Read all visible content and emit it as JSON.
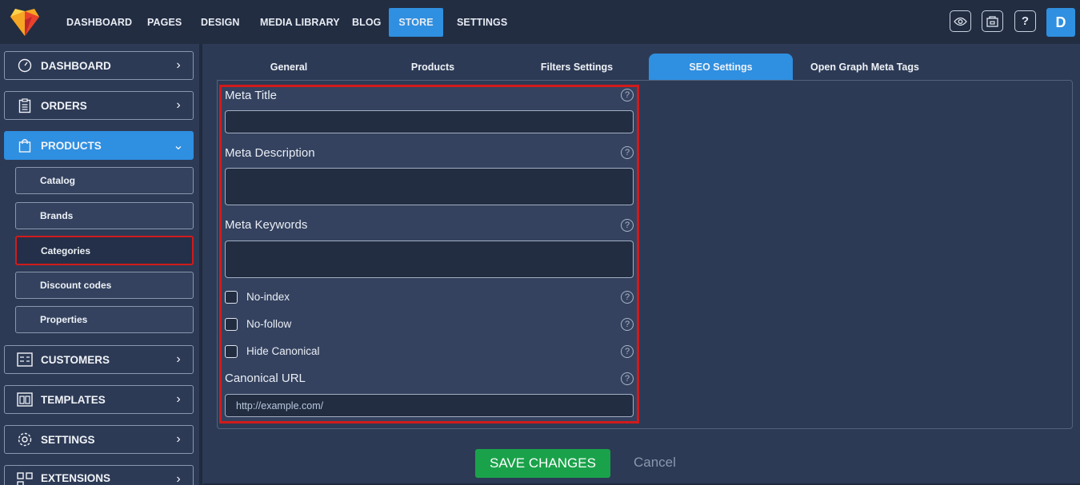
{
  "topnav": {
    "items": [
      {
        "label": "DASHBOARD"
      },
      {
        "label": "PAGES"
      },
      {
        "label": "DESIGN"
      },
      {
        "label": "MEDIA LIBRARY"
      },
      {
        "label": "BLOG"
      },
      {
        "label": "STORE",
        "active": true
      },
      {
        "label": "SETTINGS"
      }
    ],
    "icons": [
      "eye-icon",
      "store-icon",
      "help-icon"
    ],
    "help_glyph": "?",
    "avatar": "D"
  },
  "sidebar": {
    "main": [
      {
        "label": "DASHBOARD",
        "icon": "gauge-icon"
      },
      {
        "label": "ORDERS",
        "icon": "clipboard-icon"
      },
      {
        "label": "PRODUCTS",
        "icon": "bag-icon",
        "active": true
      },
      {
        "label": "CUSTOMERS",
        "icon": "contacts-icon"
      },
      {
        "label": "TEMPLATES",
        "icon": "template-icon"
      },
      {
        "label": "SETTINGS",
        "icon": "gear-icon"
      },
      {
        "label": "EXTENSIONS",
        "icon": "grid-icon"
      }
    ],
    "sub": [
      {
        "label": "Catalog"
      },
      {
        "label": "Brands"
      },
      {
        "label": "Categories",
        "selected": true
      },
      {
        "label": "Discount codes"
      },
      {
        "label": "Properties"
      }
    ]
  },
  "tabs": [
    {
      "label": "General"
    },
    {
      "label": "Products"
    },
    {
      "label": "Filters Settings"
    },
    {
      "label": "SEO Settings",
      "active": true
    },
    {
      "label": "Open Graph Meta Tags"
    }
  ],
  "seo": {
    "meta_title_label": "Meta Title",
    "meta_title_value": "",
    "meta_description_label": "Meta Description",
    "meta_description_value": "",
    "meta_keywords_label": "Meta Keywords",
    "meta_keywords_value": "",
    "noindex_label": "No-index",
    "nofollow_label": "No-follow",
    "hide_canonical_label": "Hide Canonical",
    "canonical_label": "Canonical URL",
    "canonical_value": "http://example.com/",
    "help_glyph": "?"
  },
  "actions": {
    "save_label": "SAVE CHANGES",
    "cancel_label": "Cancel"
  },
  "colors": {
    "accent": "#2f8fe0",
    "save": "#1aa24a",
    "highlight": "#d11b1b",
    "background": "#2d3a55"
  }
}
